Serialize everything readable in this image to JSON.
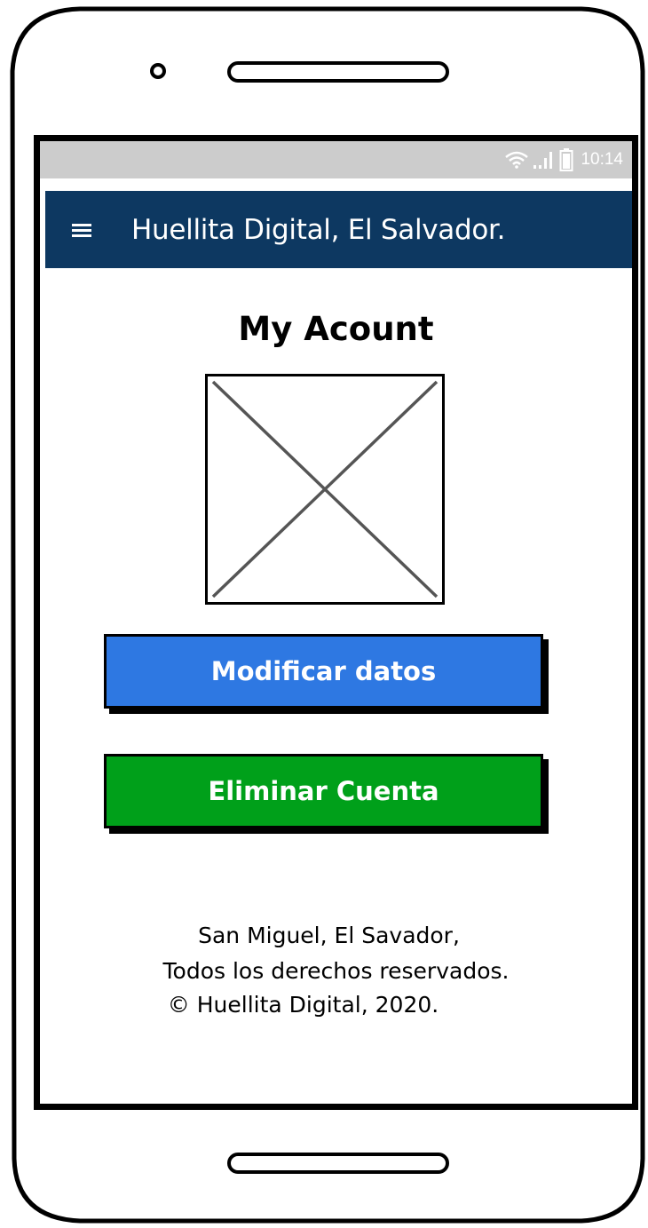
{
  "status_bar": {
    "time": "10:14",
    "icons": [
      "wifi-icon",
      "signal-icon",
      "battery-icon"
    ]
  },
  "app_bar": {
    "menu_icon": "hamburger-menu-icon",
    "title": "Huellita Digital, El Salvador."
  },
  "page": {
    "title": "My Acount",
    "avatar_icon": "image-placeholder-icon"
  },
  "buttons": {
    "modify_label": "Modificar datos",
    "delete_label": "Eliminar Cuenta"
  },
  "footer": {
    "line1": "San Miguel, El Savador,",
    "line2": "Todos los derechos reservados.",
    "line3": "© Huellita Digital, 2020."
  },
  "colors": {
    "app_bar": "#0d3861",
    "status_bar": "#cccccc",
    "modify_button": "#2e78e2",
    "delete_button": "#00a01a"
  }
}
